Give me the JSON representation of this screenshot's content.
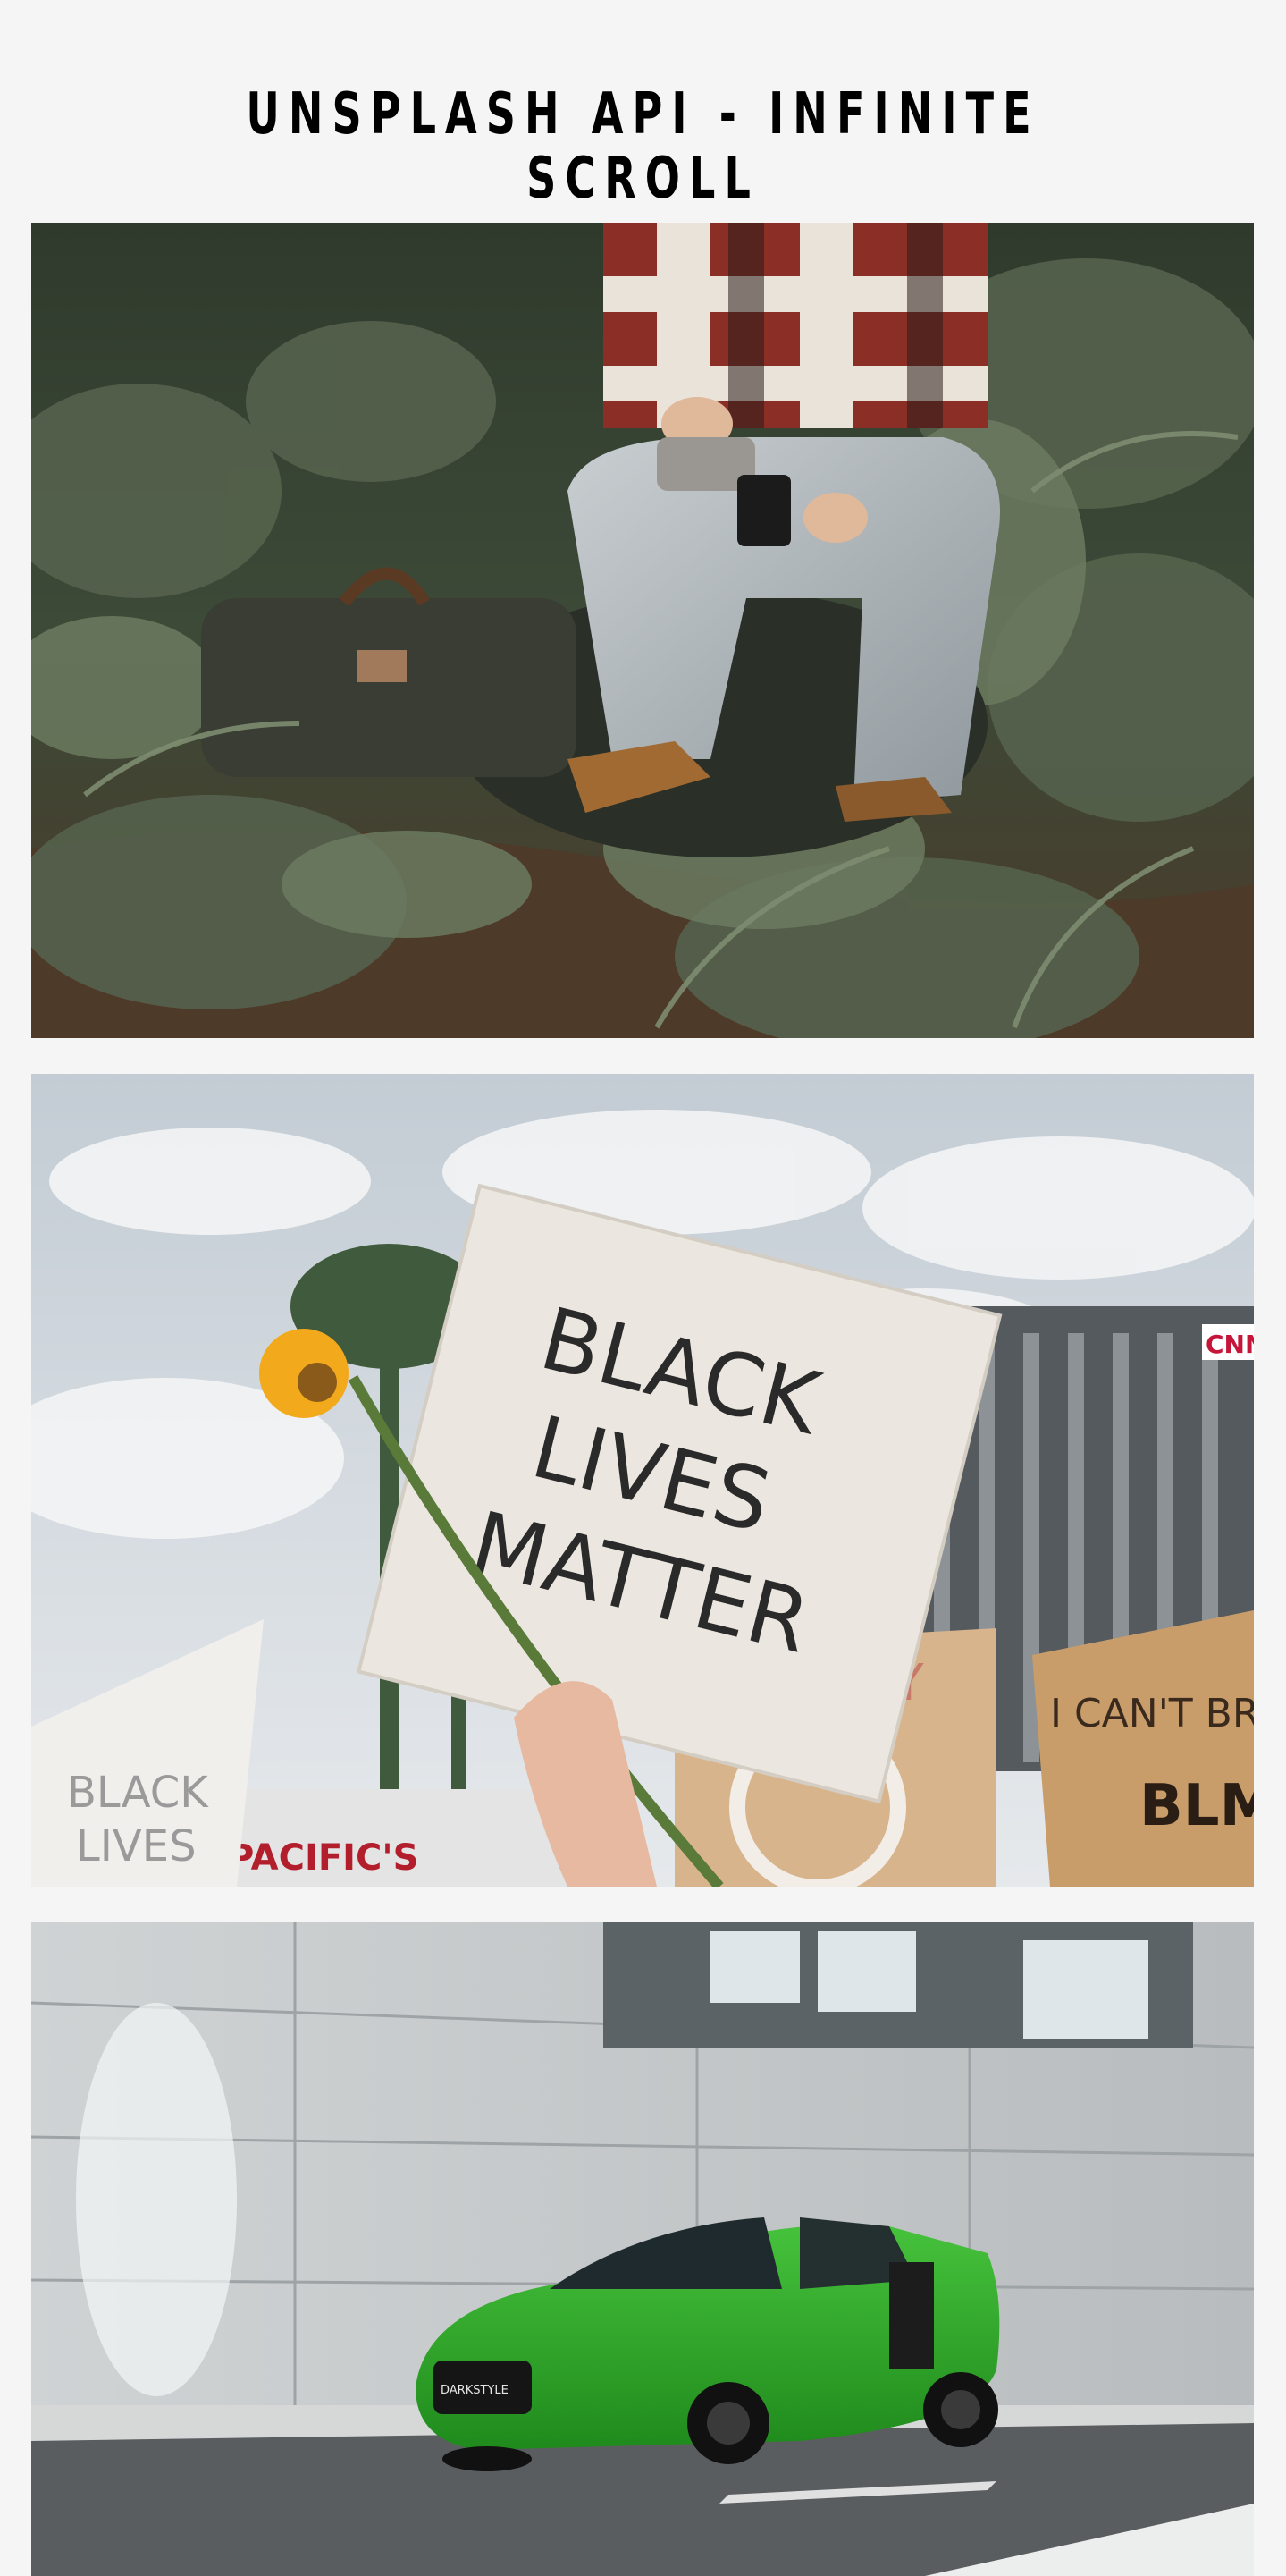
{
  "page": {
    "title": "UNSPLASH API - INFINITE SCROLL",
    "background_color": "#f5f5f5"
  },
  "gallery": {
    "photos": [
      {
        "alt": "Person sitting in a fern forest pouring coffee beside a bag",
        "dominant_color": "#3c4236"
      },
      {
        "alt": "Protest sign reading Black Lives Matter held up with a sunflower",
        "dominant_color": "#b9c3cc",
        "sign_texts": [
          "BLACK",
          "LIVES",
          "MATTER"
        ],
        "background_signs": [
          "BLACK",
          "LIVES",
          "EVERY",
          "I CAN'T BR",
          "BLM",
          "PACIFIC'S",
          "CNN"
        ]
      },
      {
        "alt": "Green sports car parked in front of a grey panelled building",
        "dominant_color": "#c4c8c9",
        "plate_text": "DARKSTYLE"
      }
    ]
  }
}
